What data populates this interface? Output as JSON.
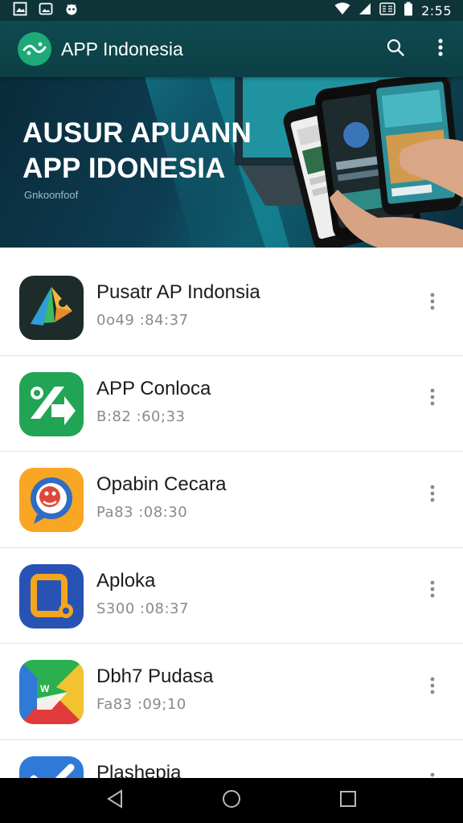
{
  "status_bar": {
    "time": "2:55"
  },
  "toolbar": {
    "title": "APP Indonesia",
    "search_icon": "search-icon",
    "more_icon": "more-vert-icon"
  },
  "banner": {
    "line1": "AUSUR APUANN",
    "line2": "APP IDONESIA",
    "subtitle": "Gnkoonfoof"
  },
  "apps": [
    {
      "title": "Pusatr AP Indonsia",
      "meta": "0o49 :84:37",
      "icon": "map-navigation-icon",
      "colors": [
        "#1d2b2a",
        "#f2b640",
        "#2f9ed8",
        "#3dbb5d"
      ]
    },
    {
      "title": "APP Conloca",
      "meta": "B:82 :60;33",
      "icon": "percent-arrow-icon",
      "colors": [
        "#21a454",
        "#ffffff"
      ]
    },
    {
      "title": "Opabin Cecara",
      "meta": "Pa83 :08:30",
      "icon": "chat-face-icon",
      "colors": [
        "#f8a623",
        "#2f6cc4",
        "#e0483a"
      ]
    },
    {
      "title": "Aploka",
      "meta": "S300 :08:37",
      "icon": "square-dot-icon",
      "colors": [
        "#2853b5",
        "#f3a51e"
      ]
    },
    {
      "title": "Dbh7 Pudasa",
      "meta": "Fa83 :09;10",
      "icon": "play-triangle-icon",
      "colors": [
        "#2e7ad6",
        "#e03a3a",
        "#f2c230",
        "#2bb04f"
      ]
    },
    {
      "title": "Plashepia",
      "meta": "",
      "icon": "check-icon",
      "colors": [
        "#2f7ad8",
        "#ffffff"
      ]
    }
  ],
  "nav": {
    "back_icon": "back-icon",
    "home_icon": "home-icon",
    "recents_icon": "recents-icon"
  }
}
